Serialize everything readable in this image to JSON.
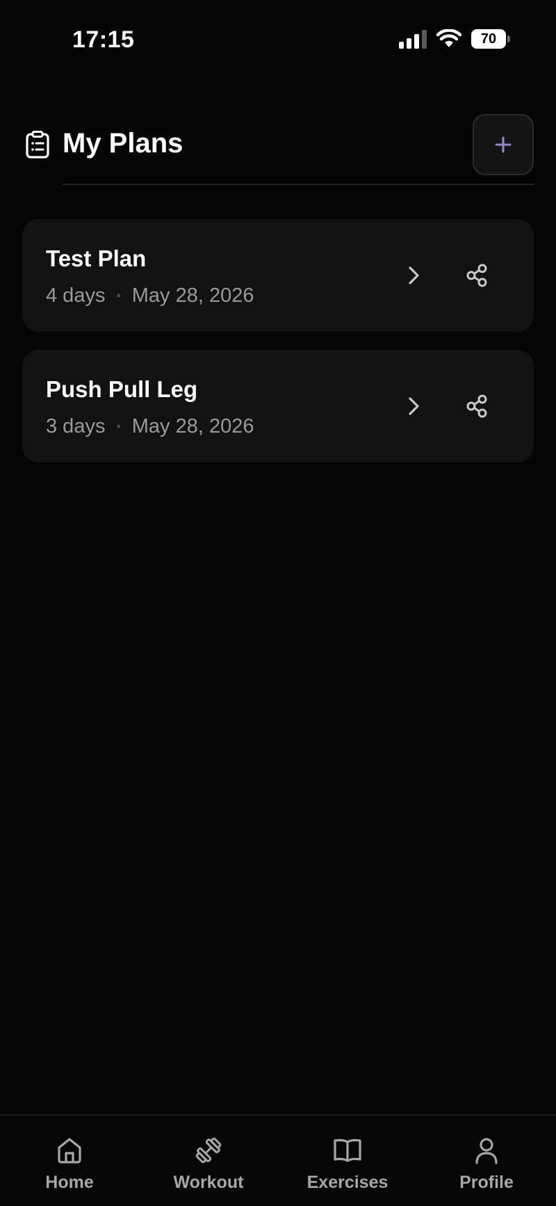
{
  "status_bar": {
    "time": "17:15",
    "battery": "70",
    "icons": [
      "signal-icon",
      "wifi-icon",
      "battery-icon"
    ]
  },
  "header": {
    "title": "My Plans",
    "icon": "clipboard-list-icon",
    "add_icon": "plus-icon"
  },
  "plans": [
    {
      "name": "Test Plan",
      "days": "4 days",
      "date": "May 28, 2026"
    },
    {
      "name": "Push Pull Leg",
      "days": "3 days",
      "date": "May 28, 2026"
    }
  ],
  "nav": {
    "items": [
      {
        "label": "Home",
        "icon": "home-icon"
      },
      {
        "label": "Workout",
        "icon": "dumbbell-icon"
      },
      {
        "label": "Exercises",
        "icon": "book-open-icon"
      },
      {
        "label": "Profile",
        "icon": "user-icon"
      }
    ]
  },
  "colors": {
    "background": "#050505",
    "card": "#121212",
    "accent": "#9b86c9",
    "muted_text": "#9a9a9a",
    "nav_text": "#a7a7a7"
  }
}
